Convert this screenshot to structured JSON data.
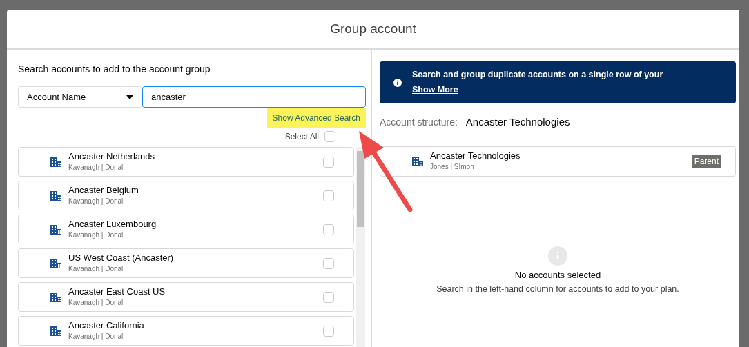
{
  "modal": {
    "title": "Group account"
  },
  "search_panel": {
    "heading": "Search accounts to add to the account group",
    "field_select": "Account Name",
    "search_value": "ancaster",
    "advanced_link": {
      "label": "Show Advanced Search",
      "highlighted": true
    },
    "select_all": {
      "label": "Select All",
      "checked": false
    },
    "results": [
      {
        "name": "Ancaster Netherlands",
        "owner": "Kavanagh | Donal",
        "checked": false
      },
      {
        "name": "Ancaster Belgium",
        "owner": "Kavanagh | Donal",
        "checked": false
      },
      {
        "name": "Ancaster Luxembourg",
        "owner": "Kavanagh | Donal",
        "checked": false
      },
      {
        "name": "US West Coast (Ancaster)",
        "owner": "Kavanagh | Donal",
        "checked": false
      },
      {
        "name": "Ancaster East Coast US",
        "owner": "Kavanagh | Donal",
        "checked": false
      },
      {
        "name": "Ancaster California",
        "owner": "Kavanagh | Donal",
        "checked": false
      }
    ]
  },
  "structure_panel": {
    "banner": {
      "text": "Search and group duplicate accounts on a single row of your",
      "link": "Show More"
    },
    "structure_label": "Account structure:",
    "structure_value": "Ancaster Technologies",
    "accounts": [
      {
        "name": "Ancaster Technologies",
        "owner": "Jones | SImon",
        "badge": "Parent"
      }
    ],
    "empty_state": {
      "title": "No accounts selected",
      "message": "Search in the left-hand column for accounts to add to your plan."
    }
  }
}
